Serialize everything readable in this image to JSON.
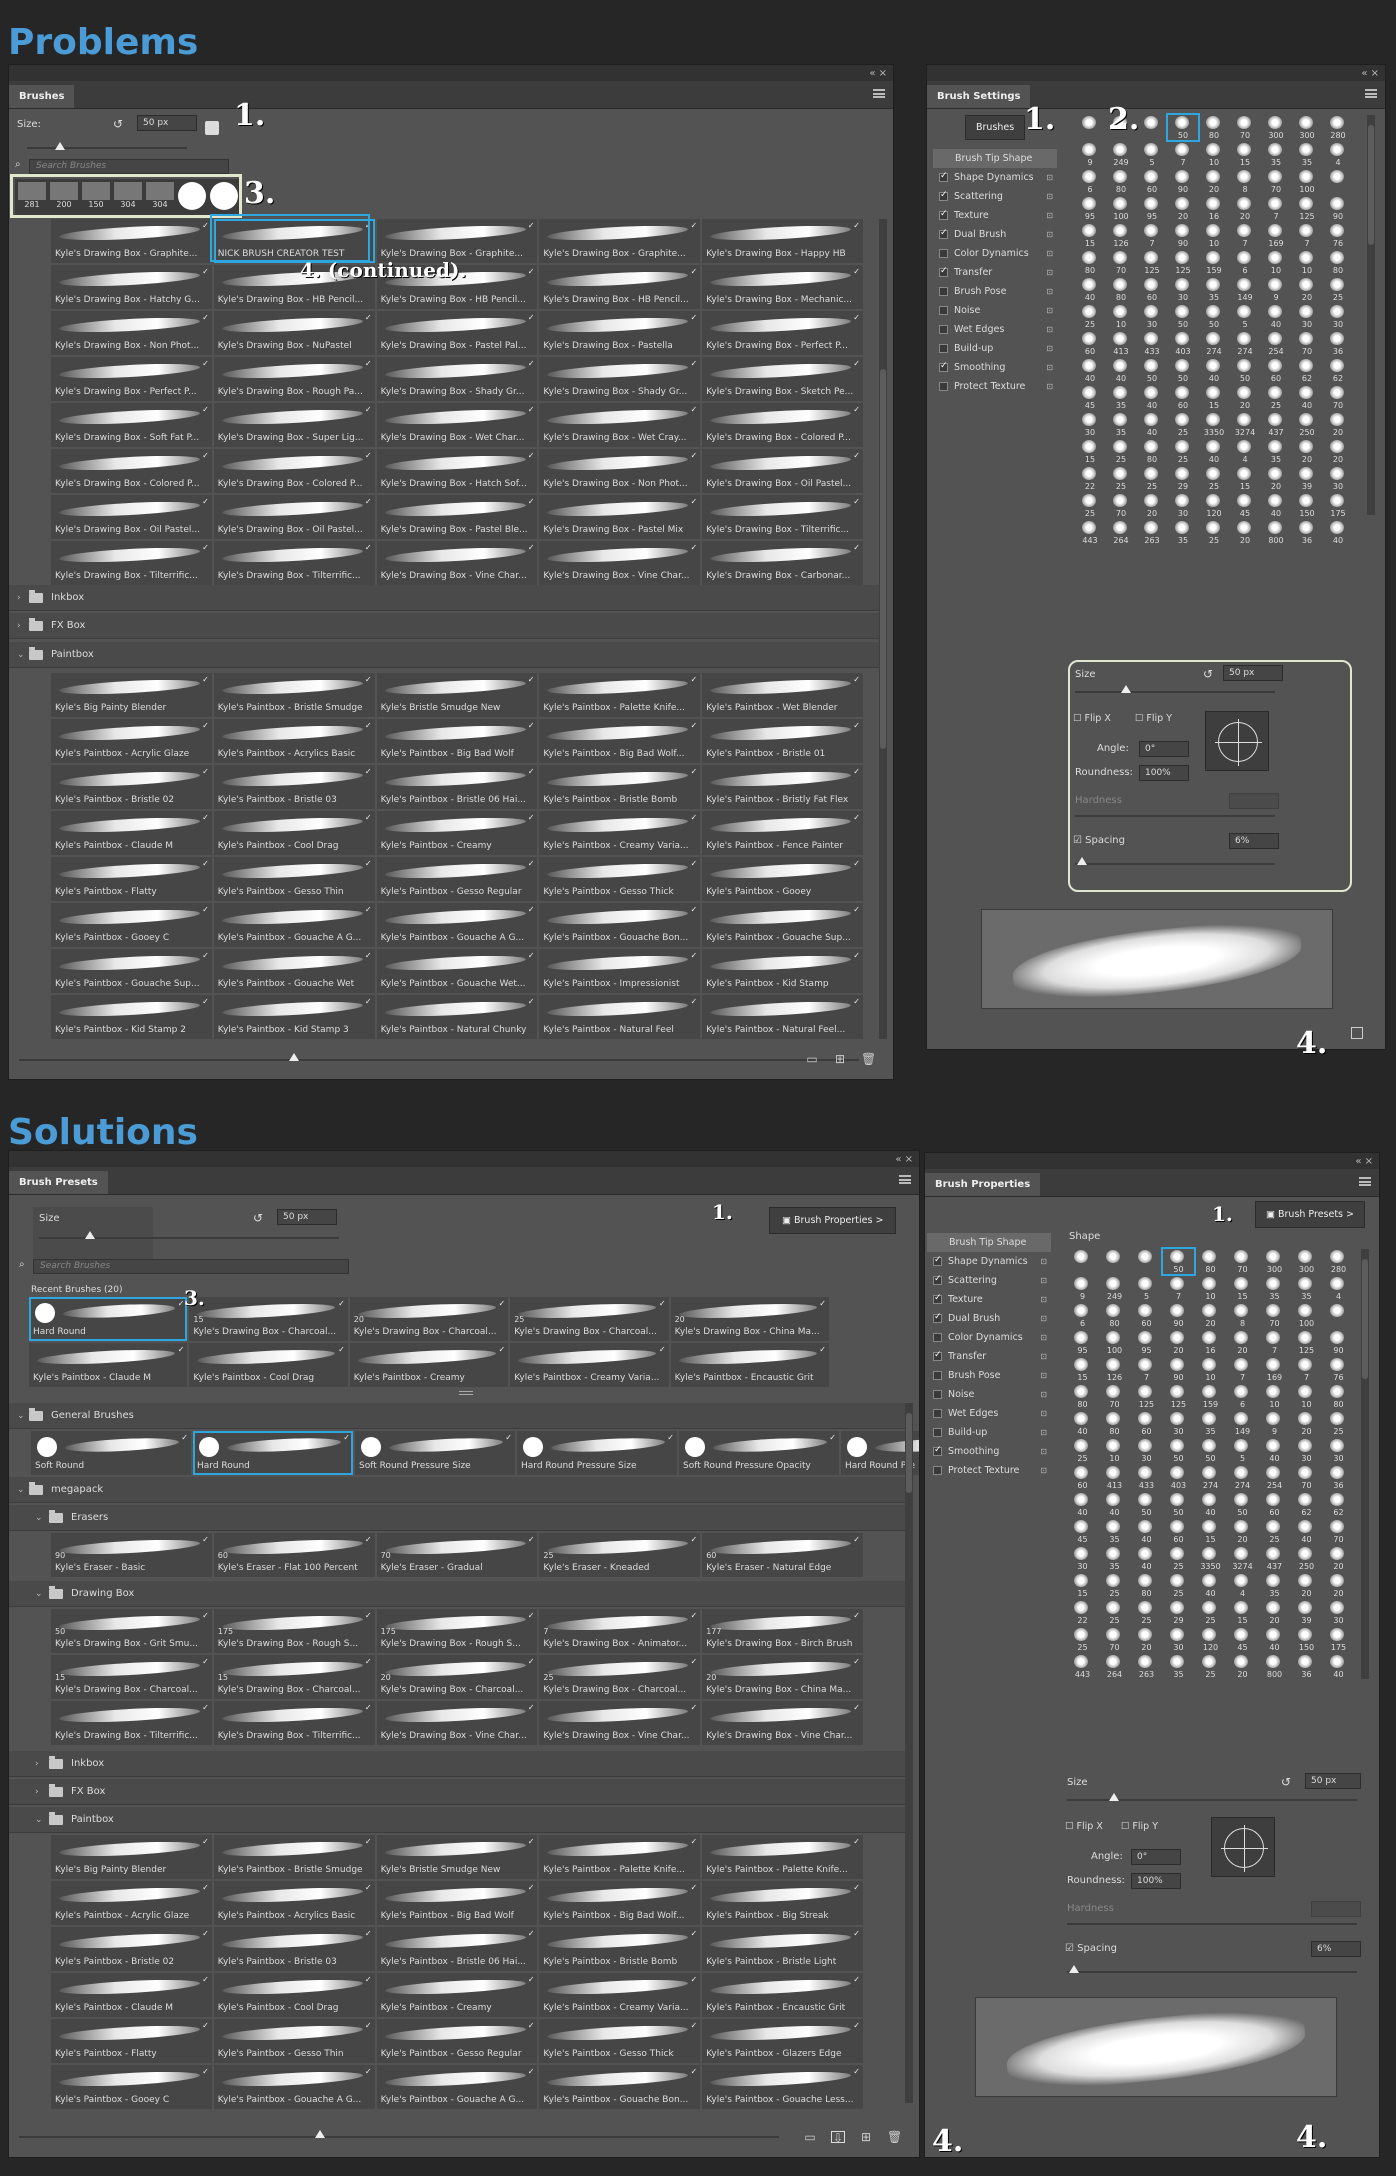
{
  "problems": {
    "heading": "Problems",
    "brushes_panel": {
      "tab": "Brushes",
      "size_label": "Size:",
      "size_value": "50 px",
      "search_placeholder": "Search Brushes",
      "recent_sizes": [
        "281",
        "200",
        "150",
        "304",
        "304"
      ],
      "cells": [
        "Kyle's Drawing Box - Graphite...",
        "NICK BRUSH CREATOR TEST",
        "Kyle's Drawing Box - Graphite...",
        "Kyle's Drawing Box - Graphite...",
        "Kyle's Drawing Box - Happy HB",
        "Kyle's Drawing Box - Hatchy G...",
        "Kyle's Drawing Box - HB Pencil...",
        "Kyle's Drawing Box - HB Pencil...",
        "Kyle's Drawing Box - HB Pencil...",
        "Kyle's Drawing Box - Mechanic...",
        "Kyle's Drawing Box - Non Phot...",
        "Kyle's Drawing Box - NuPastel",
        "Kyle's Drawing Box - Pastel Pal...",
        "Kyle's Drawing Box - Pastella",
        "Kyle's Drawing Box - Perfect P...",
        "Kyle's Drawing Box - Perfect P...",
        "Kyle's Drawing Box - Rough Pa...",
        "Kyle's Drawing Box - Shady Gr...",
        "Kyle's Drawing Box - Shady Gr...",
        "Kyle's Drawing Box - Sketch Pe...",
        "Kyle's Drawing Box - Soft Fat P...",
        "Kyle's Drawing Box - Super Lig...",
        "Kyle's Drawing Box - Wet Char...",
        "Kyle's Drawing Box - Wet Cray...",
        "Kyle's Drawing Box - Colored P...",
        "Kyle's Drawing Box - Colored P...",
        "Kyle's Drawing Box - Colored P...",
        "Kyle's Drawing Box - Hatch Sof...",
        "Kyle's Drawing Box - Non Phot...",
        "Kyle's Drawing Box - Oil Pastel...",
        "Kyle's Drawing Box - Oil Pastel...",
        "Kyle's Drawing Box - Oil Pastel...",
        "Kyle's Drawing Box - Pastel Ble...",
        "Kyle's Drawing Box - Pastel Mix",
        "Kyle's Drawing Box - Tilterrific...",
        "Kyle's Drawing Box - Tilterrific...",
        "Kyle's Drawing Box - Tilterrific...",
        "Kyle's Drawing Box - Vine Char...",
        "Kyle's Drawing Box - Vine Char...",
        "Kyle's Drawing Box - Carbonar..."
      ],
      "folders": [
        "Inkbox",
        "FX Box",
        "Paintbox"
      ],
      "paint_cells": [
        "Kyle's Big Painty Blender",
        "Kyle's Paintbox - Bristle Smudge",
        "Kyle's Bristle Smudge New",
        "Kyle's Paintbox - Palette Knife...",
        "Kyle's Paintbox - Wet Blender",
        "Kyle's Paintbox - Acrylic Glaze",
        "Kyle's Paintbox - Acrylics Basic",
        "Kyle's Paintbox - Big Bad Wolf",
        "Kyle's Paintbox - Big Bad Wolf...",
        "Kyle's Paintbox - Bristle 01",
        "Kyle's Paintbox - Bristle 02",
        "Kyle's Paintbox - Bristle 03",
        "Kyle's Paintbox - Bristle 06 Hai...",
        "Kyle's Paintbox - Bristle Bomb",
        "Kyle's Paintbox - Bristly Fat Flex",
        "Kyle's Paintbox - Claude M",
        "Kyle's Paintbox - Cool Drag",
        "Kyle's Paintbox - Creamy",
        "Kyle's Paintbox - Creamy Varia...",
        "Kyle's Paintbox - Fence Painter",
        "Kyle's Paintbox - Flatty",
        "Kyle's Paintbox - Gesso Thin",
        "Kyle's Paintbox - Gesso Regular",
        "Kyle's Paintbox - Gesso Thick",
        "Kyle's Paintbox - Gooey",
        "Kyle's Paintbox - Gooey C",
        "Kyle's Paintbox - Gouache A G...",
        "Kyle's Paintbox - Gouache A G...",
        "Kyle's Paintbox - Gouache Bon...",
        "Kyle's Paintbox - Gouache Sup...",
        "Kyle's Paintbox - Gouache Sup...",
        "Kyle's Paintbox - Gouache Wet",
        "Kyle's Paintbox - Gouache Wet...",
        "Kyle's Paintbox - Impressionist",
        "Kyle's Paintbox - Kid Stamp",
        "Kyle's Paintbox - Kid Stamp 2",
        "Kyle's Paintbox - Kid Stamp 3",
        "Kyle's Paintbox - Natural Chunky",
        "Kyle's Paintbox - Natural Feel",
        "Kyle's Paintbox - Natural Feel..."
      ]
    },
    "settings_panel": {
      "tab": "Brush Settings",
      "brushes_button": "Brushes",
      "list": [
        {
          "label": "Brush Tip Shape",
          "checked": null
        },
        {
          "label": "Shape Dynamics",
          "checked": true
        },
        {
          "label": "Scattering",
          "checked": true
        },
        {
          "label": "Texture",
          "checked": true
        },
        {
          "label": "Dual Brush",
          "checked": true
        },
        {
          "label": "Color Dynamics",
          "checked": false
        },
        {
          "label": "Transfer",
          "checked": true
        },
        {
          "label": "Brush Pose",
          "checked": false
        },
        {
          "label": "Noise",
          "checked": false
        },
        {
          "label": "Wet Edges",
          "checked": false
        },
        {
          "label": "Build-up",
          "checked": false
        },
        {
          "label": "Smoothing",
          "checked": true
        },
        {
          "label": "Protect Texture",
          "checked": false
        }
      ],
      "size_label": "Size",
      "size_value": "50 px",
      "flip_x": "Flip X",
      "flip_y": "Flip Y",
      "angle_label": "Angle:",
      "angle_value": "0°",
      "roundness_label": "Roundness:",
      "roundness_value": "100%",
      "hardness_label": "Hardness",
      "spacing_label": "Spacing",
      "spacing_value": "6%"
    },
    "callouts": {
      "one_a": "1.",
      "one_b": "1.",
      "two": "2.",
      "three": "3.",
      "four_cont": "4. (continued).",
      "four": "4."
    }
  },
  "solutions": {
    "heading": "Solutions",
    "presets_panel": {
      "tab": "Brush Presets",
      "size_label": "Size",
      "size_value": "50 px",
      "brush_properties_button": "Brush Properties >",
      "search_placeholder": "Search Brushes",
      "recent_label": "Recent Brushes (20)",
      "recent_cells": [
        {
          "num": "",
          "label": "Hard Round"
        },
        {
          "num": "15",
          "label": "Kyle's Drawing Box - Charcoal..."
        },
        {
          "num": "20",
          "label": "Kyle's Drawing Box - Charcoal..."
        },
        {
          "num": "25",
          "label": "Kyle's Drawing Box - Charcoal..."
        },
        {
          "num": "20",
          "label": "Kyle's Drawing Box - China Ma..."
        },
        {
          "num": "",
          "label": "Kyle's Paintbox - Claude M"
        },
        {
          "num": "",
          "label": "Kyle's Paintbox - Cool Drag"
        },
        {
          "num": "",
          "label": "Kyle's Paintbox - Creamy"
        },
        {
          "num": "",
          "label": "Kyle's Paintbox - Creamy Varia..."
        },
        {
          "num": "",
          "label": "Kyle's Paintbox - Encaustic Grit"
        }
      ],
      "general_folder": "General Brushes",
      "general_cells": [
        "Soft Round",
        "Hard Round",
        "Soft Round Pressure Size",
        "Hard Round Pressure Size",
        "Soft Round Pressure Opacity",
        "Hard Round Pre"
      ],
      "megapack_folder": "megapack",
      "erasers_folder": "Erasers",
      "eraser_cells": [
        {
          "num": "90",
          "label": "Kyle's Eraser - Basic"
        },
        {
          "num": "60",
          "label": "Kyle's Eraser - Flat 100 Percent"
        },
        {
          "num": "70",
          "label": "Kyle's Eraser - Gradual"
        },
        {
          "num": "25",
          "label": "Kyle's Eraser - Kneaded"
        },
        {
          "num": "60",
          "label": "Kyle's Eraser - Natural Edge"
        }
      ],
      "drawing_folder": "Drawing Box",
      "drawing_cells": [
        {
          "num": "50",
          "label": "Kyle's Drawing Box - Grit Smu..."
        },
        {
          "num": "175",
          "label": "Kyle's Drawing Box - Rough S..."
        },
        {
          "num": "175",
          "label": "Kyle's Drawing Box - Rough S..."
        },
        {
          "num": "7",
          "label": "Kyle's Drawing Box - Animator..."
        },
        {
          "num": "177",
          "label": "Kyle's Drawing Box - Birch Brush"
        },
        {
          "num": "15",
          "label": "Kyle's Drawing Box - Charcoal..."
        },
        {
          "num": "15",
          "label": "Kyle's Drawing Box - Charcoal..."
        },
        {
          "num": "20",
          "label": "Kyle's Drawing Box - Charcoal..."
        },
        {
          "num": "25",
          "label": "Kyle's Drawing Box - Charcoal..."
        },
        {
          "num": "20",
          "label": "Kyle's Drawing Box - China Ma..."
        },
        {
          "num": "",
          "label": "Kyle's Drawing Box - Tilterrific..."
        },
        {
          "num": "",
          "label": "Kyle's Drawing Box - Tilterrific..."
        },
        {
          "num": "",
          "label": "Kyle's Drawing Box - Vine Char..."
        },
        {
          "num": "",
          "label": "Kyle's Drawing Box - Vine Char..."
        },
        {
          "num": "",
          "label": "Kyle's Drawing Box - Vine Char..."
        }
      ],
      "folders": [
        "Inkbox",
        "FX Box",
        "Paintbox"
      ],
      "paint_cells": [
        "Kyle's Big Painty Blender",
        "Kyle's Paintbox - Bristle Smudge",
        "Kyle's Bristle Smudge New",
        "Kyle's Paintbox - Palette Knife...",
        "Kyle's Paintbox - Palette Knife...",
        "Kyle's Paintbox - Acrylic Glaze",
        "Kyle's Paintbox - Acrylics Basic",
        "Kyle's Paintbox - Big Bad Wolf",
        "Kyle's Paintbox - Big Bad Wolf...",
        "Kyle's Paintbox - Big Streak",
        "Kyle's Paintbox - Bristle 02",
        "Kyle's Paintbox - Bristle 03",
        "Kyle's Paintbox - Bristle 06 Hai...",
        "Kyle's Paintbox - Bristle Bomb",
        "Kyle's Paintbox - Bristle Light",
        "Kyle's Paintbox - Claude M",
        "Kyle's Paintbox - Cool Drag",
        "Kyle's Paintbox - Creamy",
        "Kyle's Paintbox - Creamy Varia...",
        "Kyle's Paintbox - Encaustic Grit",
        "Kyle's Paintbox - Flatty",
        "Kyle's Paintbox - Gesso Thin",
        "Kyle's Paintbox - Gesso Regular",
        "Kyle's Paintbox - Gesso Thick",
        "Kyle's Paintbox - Glazers Edge",
        "Kyle's Paintbox - Gooey C",
        "Kyle's Paintbox - Gouache A G...",
        "Kyle's Paintbox - Gouache A G...",
        "Kyle's Paintbox - Gouache Bon...",
        "Kyle's Paintbox - Gouache Less..."
      ]
    },
    "properties_panel": {
      "tab": "Brush Properties",
      "presets_button": "Brush Presets >",
      "shape_label": "Shape",
      "list": [
        {
          "label": "Brush Tip Shape",
          "checked": null
        },
        {
          "label": "Shape Dynamics",
          "checked": true
        },
        {
          "label": "Scattering",
          "checked": true
        },
        {
          "label": "Texture",
          "checked": true
        },
        {
          "label": "Dual Brush",
          "checked": true
        },
        {
          "label": "Color Dynamics",
          "checked": false
        },
        {
          "label": "Transfer",
          "checked": true
        },
        {
          "label": "Brush Pose",
          "checked": false
        },
        {
          "label": "Noise",
          "checked": false
        },
        {
          "label": "Wet Edges",
          "checked": false
        },
        {
          "label": "Build-up",
          "checked": false
        },
        {
          "label": "Smoothing",
          "checked": true
        },
        {
          "label": "Protect Texture",
          "checked": false
        }
      ],
      "size_label": "Size",
      "size_value": "50 px",
      "flip_x": "Flip X",
      "flip_y": "Flip Y",
      "angle_label": "Angle:",
      "angle_value": "0°",
      "roundness_label": "Roundness:",
      "roundness_value": "100%",
      "hardness_label": "Hardness",
      "spacing_label": "Spacing",
      "spacing_value": "6%"
    },
    "callouts": {
      "one_a": "1.",
      "one_b": "1.",
      "three": "3.",
      "four_a": "4.",
      "four_b": "4."
    }
  },
  "tip_sizes": [
    "",
    "",
    "",
    "50",
    "80",
    "70",
    "300",
    "300",
    "280",
    "",
    "9",
    "249",
    "5",
    "7",
    "10",
    "15",
    "35",
    "35",
    "4",
    "",
    "6",
    "80",
    "60",
    "90",
    "20",
    "8",
    "70",
    "100",
    "",
    "",
    "95",
    "100",
    "95",
    "20",
    "16",
    "20",
    "7",
    "125",
    "90",
    "",
    "15",
    "126",
    "7",
    "90",
    "10",
    "7",
    "169",
    "7",
    "76",
    "",
    "80",
    "70",
    "125",
    "125",
    "159",
    "6",
    "10",
    "10",
    "80",
    "",
    "40",
    "80",
    "60",
    "30",
    "35",
    "149",
    "9",
    "20",
    "25",
    "",
    "25",
    "10",
    "30",
    "50",
    "50",
    "5",
    "40",
    "30",
    "30",
    "",
    "60",
    "413",
    "433",
    "403",
    "274",
    "274",
    "254",
    "70",
    "36",
    "",
    "40",
    "40",
    "50",
    "50",
    "40",
    "50",
    "60",
    "62",
    "62",
    "",
    "45",
    "35",
    "40",
    "60",
    "15",
    "20",
    "25",
    "40",
    "70",
    "",
    "30",
    "35",
    "40",
    "25",
    "3350",
    "3274",
    "437",
    "250",
    "20",
    "",
    "15",
    "25",
    "80",
    "25",
    "40",
    "4",
    "35",
    "20",
    "20",
    "",
    "22",
    "25",
    "25",
    "29",
    "25",
    "15",
    "20",
    "39",
    "30",
    "",
    "25",
    "70",
    "20",
    "30",
    "120",
    "45",
    "40",
    "150",
    "175",
    "",
    "443",
    "264",
    "263",
    "35",
    "25",
    "20",
    "800",
    "36",
    "40",
    ""
  ]
}
